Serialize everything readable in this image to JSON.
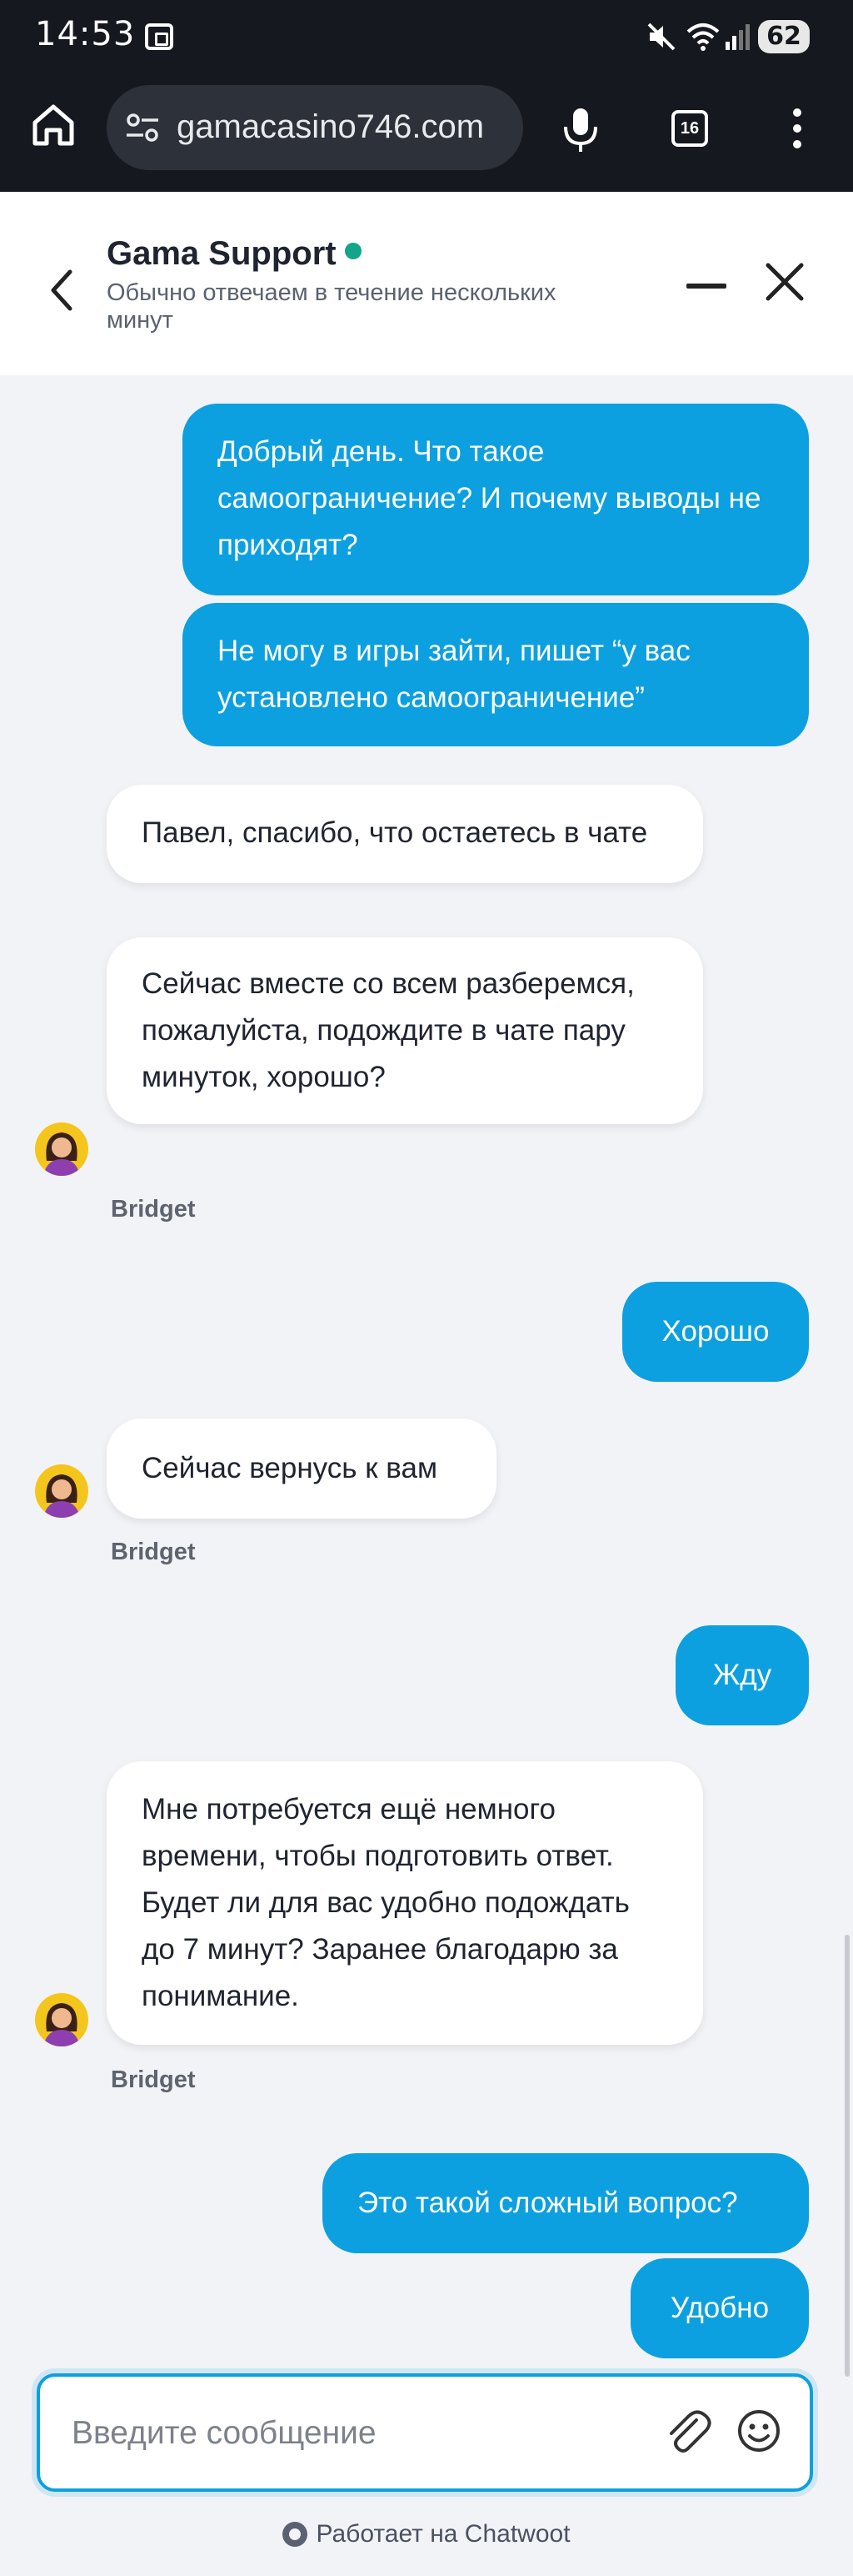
{
  "status_bar": {
    "time": "14:53",
    "battery": "62"
  },
  "browser": {
    "url": "gamacasino746.com",
    "tab_count": "16"
  },
  "chat_header": {
    "title": "Gama Support",
    "subtitle": "Обычно отвечаем в течение нескольких минут"
  },
  "messages": [
    {
      "from": "user",
      "text": "Добрый день. Что такое самоограничение? И почему выводы не приходят?"
    },
    {
      "from": "user",
      "text": "Не могу в игры зайти, пишет “у вас установлено самоограничение”"
    },
    {
      "from": "agent",
      "text": "Павел, спасибо, что остаетесь в чате"
    },
    {
      "from": "agent",
      "text": "Сейчас вместе со всем разберемся, пожалуйста, подождите в чате пару минуток, хорошо?"
    },
    {
      "from": "user",
      "text": "Хорошо"
    },
    {
      "from": "agent",
      "text": "Сейчас вернусь к вам"
    },
    {
      "from": "user",
      "text": "Жду"
    },
    {
      "from": "agent",
      "text": "Мне потребуется ещё немного времени, чтобы подготовить ответ. Будет ли для вас удобно подождать до 7 минут? Заранее благодарю за понимание."
    },
    {
      "from": "user",
      "text": "Это такой сложный вопрос?"
    },
    {
      "from": "user",
      "text": "Удобно"
    }
  ],
  "agent_name": "Bridget",
  "composer": {
    "placeholder": "Введите сообщение"
  },
  "footer": {
    "powered_by": "Работает на Chatwoot"
  },
  "colors": {
    "accent": "#0ca0e0",
    "online": "#12a58a",
    "background": "#f2f3f7"
  },
  "icons": [
    "home-icon",
    "site-settings-icon",
    "mic-icon",
    "tabs-icon",
    "more-vert-icon",
    "back-icon",
    "minimize-icon",
    "close-icon",
    "attach-icon",
    "emoji-icon",
    "chatwoot-icon"
  ]
}
